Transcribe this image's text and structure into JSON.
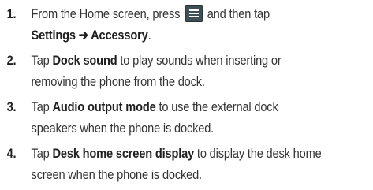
{
  "steps": [
    {
      "number": "1.",
      "line1_before": "From the Home screen, press",
      "icon": "menu-icon",
      "line1_after": "and then tap",
      "line2_bold": "Settings ➔ Accessory",
      "line2_after": "."
    },
    {
      "number": "2.",
      "line1_before": "Tap ",
      "line1_bold": "Dock sound",
      "line1_after": " to play sounds when inserting or",
      "line2": "removing the phone from the dock."
    },
    {
      "number": "3.",
      "line1_before": "Tap ",
      "line1_bold": "Audio output mode",
      "line1_after": " to use the external dock",
      "line2": "speakers when the phone is docked."
    },
    {
      "number": "4.",
      "line1_before": "Tap ",
      "line1_bold": "Desk home screen display",
      "line1_after": " to display the desk home",
      "line2": "screen when the phone is docked."
    }
  ]
}
